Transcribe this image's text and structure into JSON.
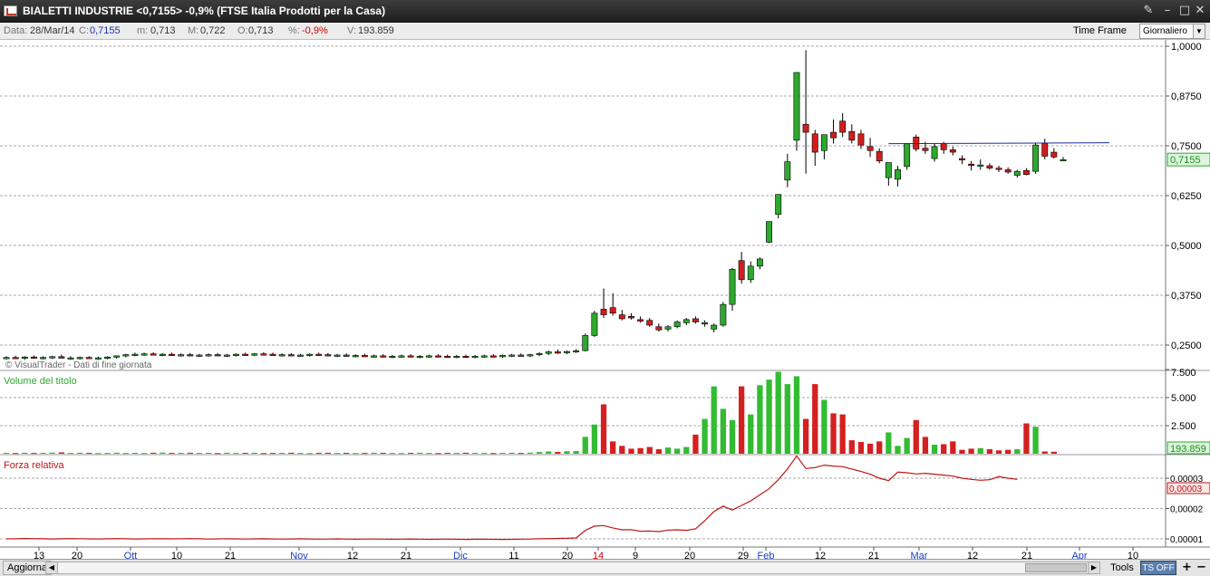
{
  "window": {
    "title": "BIALETTI INDUSTRIE <0,7155> -0,9%  (FTSE Italia Prodotti per la Casa)",
    "buttons": [
      "✎",
      "–",
      "□",
      "✕"
    ]
  },
  "infobar": {
    "data_label": "Data:",
    "data_value": "28/Mar/14",
    "close_label": "C:",
    "close_value": "0,7155",
    "min_label": "m:",
    "min_value": "0,713",
    "max_label": "M:",
    "max_value": "0,722",
    "open_label": "O:",
    "open_value": "0,713",
    "pct_label": "%:",
    "pct_value": "-0,9%",
    "vol_label": "V:",
    "vol_value": "193.859",
    "timeframe_label": "Time Frame",
    "timeframe_value": "Giornaliero"
  },
  "chart": {
    "watermark": "© VisualTrader - Dati di fine giornata",
    "price_ticks": [
      "1,0000",
      "0,8750",
      "0,7500",
      "0,6250",
      "0,5000",
      "0,3750",
      "0,2500"
    ],
    "last_price_tag": "0,7155",
    "volume_panel": {
      "title": "Volume del titolo",
      "ticks": [
        "7.500",
        "5.000",
        "2.500"
      ],
      "last_tag": "193.859"
    },
    "rs_panel": {
      "title": "Forza relativa",
      "ticks": [
        "0,00003",
        "0,00002",
        "0,00001"
      ],
      "last_tag": "0,00003"
    },
    "x_ticks": [
      {
        "label": "13",
        "color": "#000"
      },
      {
        "label": "20",
        "color": "#000"
      },
      {
        "label": "Ott",
        "color": "#1a3fc4"
      },
      {
        "label": "10",
        "color": "#000"
      },
      {
        "label": "21",
        "color": "#000"
      },
      {
        "label": "Nov",
        "color": "#1a3fc4"
      },
      {
        "label": "12",
        "color": "#000"
      },
      {
        "label": "21",
        "color": "#000"
      },
      {
        "label": "Dic",
        "color": "#1a3fc4"
      },
      {
        "label": "11",
        "color": "#000"
      },
      {
        "label": "20",
        "color": "#000"
      },
      {
        "label": "14",
        "color": "#d00000"
      },
      {
        "label": "9",
        "color": "#000"
      },
      {
        "label": "20",
        "color": "#000"
      },
      {
        "label": "29",
        "color": "#000"
      },
      {
        "label": "Feb",
        "color": "#1a3fc4"
      },
      {
        "label": "12",
        "color": "#000"
      },
      {
        "label": "21",
        "color": "#000"
      },
      {
        "label": "Mar",
        "color": "#1a3fc4"
      },
      {
        "label": "12",
        "color": "#000"
      },
      {
        "label": "21",
        "color": "#000"
      },
      {
        "label": "Apr",
        "color": "#1a3fc4"
      },
      {
        "label": "10",
        "color": "#000"
      }
    ]
  },
  "chart_data": {
    "type": "candlestick",
    "title": "BIALETTI INDUSTRIE",
    "ylim": [
      0.22,
      1.0
    ],
    "colors": {
      "up": "#2ea82e",
      "down": "#d41c1c",
      "volume_up": "#33bb33",
      "volume_down": "#d42020",
      "rs_line": "#c01515",
      "resistance_line": "#1a2a9a"
    },
    "resistance_level": 0.7554,
    "candles": [
      {
        "o": 0.218,
        "h": 0.222,
        "l": 0.214,
        "c": 0.219
      },
      {
        "o": 0.219,
        "h": 0.223,
        "l": 0.215,
        "c": 0.217
      },
      {
        "o": 0.217,
        "h": 0.222,
        "l": 0.213,
        "c": 0.22
      },
      {
        "o": 0.22,
        "h": 0.224,
        "l": 0.216,
        "c": 0.218
      },
      {
        "o": 0.218,
        "h": 0.222,
        "l": 0.214,
        "c": 0.219
      },
      {
        "o": 0.219,
        "h": 0.223,
        "l": 0.215,
        "c": 0.221
      },
      {
        "o": 0.221,
        "h": 0.226,
        "l": 0.216,
        "c": 0.217
      },
      {
        "o": 0.217,
        "h": 0.222,
        "l": 0.213,
        "c": 0.218
      },
      {
        "o": 0.218,
        "h": 0.221,
        "l": 0.214,
        "c": 0.219
      },
      {
        "o": 0.219,
        "h": 0.222,
        "l": 0.215,
        "c": 0.217
      },
      {
        "o": 0.217,
        "h": 0.221,
        "l": 0.213,
        "c": 0.218
      },
      {
        "o": 0.218,
        "h": 0.222,
        "l": 0.214,
        "c": 0.22
      },
      {
        "o": 0.22,
        "h": 0.224,
        "l": 0.216,
        "c": 0.223
      },
      {
        "o": 0.223,
        "h": 0.228,
        "l": 0.219,
        "c": 0.226
      },
      {
        "o": 0.226,
        "h": 0.231,
        "l": 0.222,
        "c": 0.227
      },
      {
        "o": 0.227,
        "h": 0.231,
        "l": 0.223,
        "c": 0.228
      },
      {
        "o": 0.228,
        "h": 0.232,
        "l": 0.224,
        "c": 0.226
      },
      {
        "o": 0.226,
        "h": 0.23,
        "l": 0.222,
        "c": 0.227
      },
      {
        "o": 0.227,
        "h": 0.231,
        "l": 0.223,
        "c": 0.225
      },
      {
        "o": 0.225,
        "h": 0.229,
        "l": 0.221,
        "c": 0.226
      },
      {
        "o": 0.226,
        "h": 0.23,
        "l": 0.222,
        "c": 0.224
      },
      {
        "o": 0.224,
        "h": 0.228,
        "l": 0.22,
        "c": 0.225
      },
      {
        "o": 0.225,
        "h": 0.229,
        "l": 0.221,
        "c": 0.226
      },
      {
        "o": 0.226,
        "h": 0.23,
        "l": 0.222,
        "c": 0.224
      },
      {
        "o": 0.224,
        "h": 0.228,
        "l": 0.22,
        "c": 0.225
      },
      {
        "o": 0.225,
        "h": 0.229,
        "l": 0.221,
        "c": 0.227
      },
      {
        "o": 0.227,
        "h": 0.231,
        "l": 0.223,
        "c": 0.226
      },
      {
        "o": 0.226,
        "h": 0.23,
        "l": 0.222,
        "c": 0.228
      },
      {
        "o": 0.228,
        "h": 0.232,
        "l": 0.224,
        "c": 0.227
      },
      {
        "o": 0.227,
        "h": 0.231,
        "l": 0.223,
        "c": 0.225
      },
      {
        "o": 0.225,
        "h": 0.229,
        "l": 0.221,
        "c": 0.226
      },
      {
        "o": 0.226,
        "h": 0.23,
        "l": 0.222,
        "c": 0.224
      },
      {
        "o": 0.224,
        "h": 0.228,
        "l": 0.22,
        "c": 0.225
      },
      {
        "o": 0.225,
        "h": 0.229,
        "l": 0.221,
        "c": 0.227
      },
      {
        "o": 0.227,
        "h": 0.231,
        "l": 0.223,
        "c": 0.226
      },
      {
        "o": 0.226,
        "h": 0.23,
        "l": 0.222,
        "c": 0.224
      },
      {
        "o": 0.224,
        "h": 0.228,
        "l": 0.22,
        "c": 0.225
      },
      {
        "o": 0.225,
        "h": 0.229,
        "l": 0.221,
        "c": 0.223
      },
      {
        "o": 0.223,
        "h": 0.227,
        "l": 0.219,
        "c": 0.224
      },
      {
        "o": 0.224,
        "h": 0.228,
        "l": 0.22,
        "c": 0.222
      },
      {
        "o": 0.222,
        "h": 0.226,
        "l": 0.218,
        "c": 0.223
      },
      {
        "o": 0.223,
        "h": 0.227,
        "l": 0.219,
        "c": 0.221
      },
      {
        "o": 0.221,
        "h": 0.225,
        "l": 0.217,
        "c": 0.222
      },
      {
        "o": 0.222,
        "h": 0.226,
        "l": 0.218,
        "c": 0.223
      },
      {
        "o": 0.223,
        "h": 0.227,
        "l": 0.219,
        "c": 0.221
      },
      {
        "o": 0.221,
        "h": 0.225,
        "l": 0.217,
        "c": 0.222
      },
      {
        "o": 0.222,
        "h": 0.226,
        "l": 0.218,
        "c": 0.223
      },
      {
        "o": 0.223,
        "h": 0.227,
        "l": 0.219,
        "c": 0.222
      },
      {
        "o": 0.222,
        "h": 0.226,
        "l": 0.218,
        "c": 0.221
      },
      {
        "o": 0.221,
        "h": 0.225,
        "l": 0.217,
        "c": 0.222
      },
      {
        "o": 0.222,
        "h": 0.226,
        "l": 0.218,
        "c": 0.221
      },
      {
        "o": 0.221,
        "h": 0.225,
        "l": 0.217,
        "c": 0.222
      },
      {
        "o": 0.222,
        "h": 0.226,
        "l": 0.218,
        "c": 0.223
      },
      {
        "o": 0.223,
        "h": 0.227,
        "l": 0.219,
        "c": 0.222
      },
      {
        "o": 0.222,
        "h": 0.226,
        "l": 0.218,
        "c": 0.224
      },
      {
        "o": 0.224,
        "h": 0.228,
        "l": 0.22,
        "c": 0.225
      },
      {
        "o": 0.225,
        "h": 0.229,
        "l": 0.221,
        "c": 0.224
      },
      {
        "o": 0.224,
        "h": 0.228,
        "l": 0.22,
        "c": 0.226
      },
      {
        "o": 0.226,
        "h": 0.232,
        "l": 0.222,
        "c": 0.229
      },
      {
        "o": 0.229,
        "h": 0.236,
        "l": 0.225,
        "c": 0.233
      },
      {
        "o": 0.233,
        "h": 0.239,
        "l": 0.228,
        "c": 0.231
      },
      {
        "o": 0.231,
        "h": 0.236,
        "l": 0.227,
        "c": 0.234
      },
      {
        "o": 0.234,
        "h": 0.24,
        "l": 0.23,
        "c": 0.236
      },
      {
        "o": 0.236,
        "h": 0.279,
        "l": 0.234,
        "c": 0.274
      },
      {
        "o": 0.274,
        "h": 0.336,
        "l": 0.27,
        "c": 0.33
      },
      {
        "o": 0.34,
        "h": 0.392,
        "l": 0.318,
        "c": 0.326
      },
      {
        "o": 0.344,
        "h": 0.38,
        "l": 0.324,
        "c": 0.33
      },
      {
        "o": 0.326,
        "h": 0.338,
        "l": 0.312,
        "c": 0.316
      },
      {
        "o": 0.322,
        "h": 0.33,
        "l": 0.314,
        "c": 0.318
      },
      {
        "o": 0.314,
        "h": 0.322,
        "l": 0.306,
        "c": 0.31
      },
      {
        "o": 0.312,
        "h": 0.318,
        "l": 0.296,
        "c": 0.3
      },
      {
        "o": 0.296,
        "h": 0.304,
        "l": 0.284,
        "c": 0.288
      },
      {
        "o": 0.29,
        "h": 0.3,
        "l": 0.284,
        "c": 0.296
      },
      {
        "o": 0.296,
        "h": 0.312,
        "l": 0.292,
        "c": 0.308
      },
      {
        "o": 0.306,
        "h": 0.318,
        "l": 0.3,
        "c": 0.314
      },
      {
        "o": 0.316,
        "h": 0.322,
        "l": 0.304,
        "c": 0.308
      },
      {
        "o": 0.304,
        "h": 0.312,
        "l": 0.296,
        "c": 0.306
      },
      {
        "o": 0.29,
        "h": 0.304,
        "l": 0.282,
        "c": 0.3
      },
      {
        "o": 0.3,
        "h": 0.358,
        "l": 0.296,
        "c": 0.352
      },
      {
        "o": 0.352,
        "h": 0.444,
        "l": 0.336,
        "c": 0.44
      },
      {
        "o": 0.462,
        "h": 0.484,
        "l": 0.404,
        "c": 0.414
      },
      {
        "o": 0.414,
        "h": 0.46,
        "l": 0.406,
        "c": 0.448
      },
      {
        "o": 0.448,
        "h": 0.47,
        "l": 0.44,
        "c": 0.466
      },
      {
        "o": 0.508,
        "h": 0.56,
        "l": 0.506,
        "c": 0.56
      },
      {
        "o": 0.578,
        "h": 0.628,
        "l": 0.568,
        "c": 0.628
      },
      {
        "o": 0.664,
        "h": 0.73,
        "l": 0.646,
        "c": 0.71
      },
      {
        "o": 0.764,
        "h": 0.934,
        "l": 0.738,
        "c": 0.934
      },
      {
        "o": 0.804,
        "h": 0.99,
        "l": 0.68,
        "c": 0.784
      },
      {
        "o": 0.78,
        "h": 0.79,
        "l": 0.7,
        "c": 0.734
      },
      {
        "o": 0.738,
        "h": 0.778,
        "l": 0.716,
        "c": 0.778
      },
      {
        "o": 0.784,
        "h": 0.816,
        "l": 0.756,
        "c": 0.77
      },
      {
        "o": 0.812,
        "h": 0.832,
        "l": 0.772,
        "c": 0.784
      },
      {
        "o": 0.786,
        "h": 0.804,
        "l": 0.756,
        "c": 0.764
      },
      {
        "o": 0.78,
        "h": 0.79,
        "l": 0.742,
        "c": 0.752
      },
      {
        "o": 0.748,
        "h": 0.77,
        "l": 0.722,
        "c": 0.738
      },
      {
        "o": 0.736,
        "h": 0.744,
        "l": 0.706,
        "c": 0.712
      },
      {
        "o": 0.67,
        "h": 0.708,
        "l": 0.65,
        "c": 0.708
      },
      {
        "o": 0.666,
        "h": 0.7,
        "l": 0.648,
        "c": 0.69
      },
      {
        "o": 0.698,
        "h": 0.756,
        "l": 0.69,
        "c": 0.756
      },
      {
        "o": 0.772,
        "h": 0.778,
        "l": 0.736,
        "c": 0.742
      },
      {
        "o": 0.744,
        "h": 0.76,
        "l": 0.73,
        "c": 0.738
      },
      {
        "o": 0.718,
        "h": 0.756,
        "l": 0.71,
        "c": 0.748
      },
      {
        "o": 0.756,
        "h": 0.76,
        "l": 0.73,
        "c": 0.74
      },
      {
        "o": 0.74,
        "h": 0.748,
        "l": 0.726,
        "c": 0.734
      },
      {
        "o": 0.718,
        "h": 0.726,
        "l": 0.704,
        "c": 0.716
      },
      {
        "o": 0.704,
        "h": 0.712,
        "l": 0.688,
        "c": 0.702
      },
      {
        "o": 0.7,
        "h": 0.716,
        "l": 0.69,
        "c": 0.702
      },
      {
        "o": 0.7,
        "h": 0.706,
        "l": 0.69,
        "c": 0.694
      },
      {
        "o": 0.694,
        "h": 0.7,
        "l": 0.684,
        "c": 0.692
      },
      {
        "o": 0.69,
        "h": 0.696,
        "l": 0.68,
        "c": 0.684
      },
      {
        "o": 0.676,
        "h": 0.69,
        "l": 0.67,
        "c": 0.686
      },
      {
        "o": 0.688,
        "h": 0.694,
        "l": 0.676,
        "c": 0.678
      },
      {
        "o": 0.686,
        "h": 0.758,
        "l": 0.68,
        "c": 0.752
      },
      {
        "o": 0.756,
        "h": 0.768,
        "l": 0.716,
        "c": 0.724
      },
      {
        "o": 0.734,
        "h": 0.744,
        "l": 0.718,
        "c": 0.722
      },
      {
        "o": 0.713,
        "h": 0.722,
        "l": 0.713,
        "c": 0.7155
      }
    ],
    "volume": [
      80,
      60,
      90,
      70,
      80,
      100,
      120,
      70,
      90,
      80,
      60,
      70,
      90,
      70,
      80,
      60,
      90,
      100,
      70,
      80,
      90,
      70,
      80,
      60,
      90,
      70,
      80,
      90,
      60,
      70,
      80,
      90,
      70,
      60,
      80,
      90,
      70,
      80,
      60,
      70,
      90,
      80,
      70,
      60,
      80,
      90,
      70,
      60,
      80,
      70,
      90,
      80,
      70,
      60,
      80,
      90,
      70,
      100,
      150,
      200,
      160,
      220,
      240,
      1500,
      2600,
      4400,
      1100,
      700,
      450,
      500,
      600,
      400,
      550,
      450,
      600,
      1700,
      3100,
      6000,
      4000,
      3000,
      6000,
      3500,
      6100,
      6600,
      7300,
      6200,
      6900,
      3100,
      6200,
      4800,
      3600,
      3500,
      1200,
      1050,
      900,
      1100,
      1900,
      700,
      1400,
      3000,
      1500,
      800,
      850,
      1100,
      350,
      450,
      500,
      400,
      300,
      350,
      400,
      2700,
      2400,
      200,
      180
    ],
    "relative_strength": [
      100000,
      100500,
      101200,
      100800,
      100300,
      99800,
      100200,
      101000,
      100600,
      100100,
      99700,
      100400,
      100900,
      100200,
      99600,
      100100,
      100700,
      100300,
      99900,
      100500,
      100800,
      100200,
      99500,
      100100,
      100600,
      100000,
      99400,
      99900,
      100400,
      99800,
      99300,
      99700,
      100200,
      99600,
      99100,
      99500,
      100000,
      99400,
      98900,
      99300,
      99800,
      99200,
      98700,
      99100,
      99600,
      99000,
      98500,
      98900,
      99300,
      98800,
      98300,
      98700,
      99100,
      98600,
      98200,
      98600,
      99000,
      99500,
      100200,
      101000,
      101500,
      102000,
      103000,
      128000,
      142000,
      144000,
      136000,
      130000,
      130500,
      125000,
      126000,
      124000,
      129000,
      130000,
      128000,
      133000,
      160000,
      190000,
      208000,
      195000,
      210000,
      225000,
      245000,
      265000,
      295000,
      330000,
      373000,
      332000,
      335000,
      343000,
      340000,
      338000,
      330000,
      322000,
      313000,
      300000,
      292000,
      320000,
      318000,
      314000,
      316000,
      313000,
      310000,
      307000,
      300000,
      296000,
      293000,
      295000,
      305000,
      300000,
      296000
    ],
    "x": [
      "13 Set",
      "20 Set",
      "Ott",
      "10 Ott",
      "21 Ott",
      "Nov",
      "12 Nov",
      "21 Nov",
      "Dic",
      "11 Dic",
      "20 Dic",
      "14 Gen",
      "9",
      "20",
      "29",
      "Feb",
      "12 Feb",
      "21 Feb",
      "Mar",
      "12 Mar",
      "21 Mar",
      "Apr",
      "10 Apr"
    ]
  }
}
